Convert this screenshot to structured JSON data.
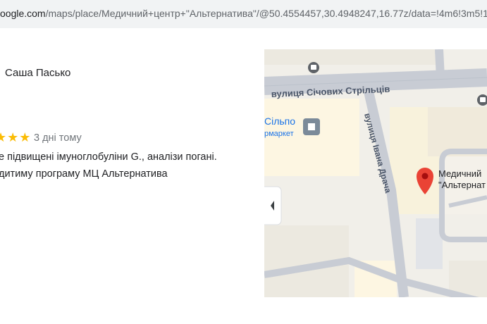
{
  "browser": {
    "url_host": "oogle.com",
    "url_path": "/maps/place/Медичний+центр+\"Альтернатива\"/@50.4554457,30.4948247,16.77z/data=!4m6!3m5!1s0x"
  },
  "review": {
    "reviewer_name": "Саша Пасько",
    "stars": "★★★",
    "rating": 3,
    "date": "3 дні тому",
    "text_line1": "е підвищені імуноглобуліни G., аналізи погані.",
    "text_line2": "дитиму програму МЦ Альтернатива"
  },
  "map": {
    "street_1": "вулиця Січових Стрільців",
    "street_2": "вулиця Івана Драча",
    "poi_1_name": "Сільпо",
    "poi_1_type": "рмаркет",
    "place_name_1": "Медичний",
    "place_name_2": "\"Альтернат",
    "collapse_icon": "chevron-left-icon",
    "marker_color": "#ea4335"
  }
}
